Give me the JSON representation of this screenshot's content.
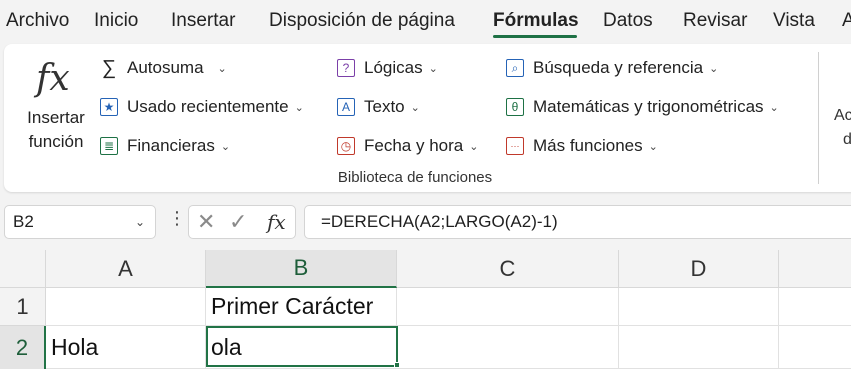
{
  "menu": {
    "tabs": [
      "Archivo",
      "Inicio",
      "Insertar",
      "Disposición de página",
      "Fórmulas",
      "Datos",
      "Revisar",
      "Vista",
      "A"
    ],
    "active": "Fórmulas"
  },
  "ribbon": {
    "insert_function": {
      "icon": "fx-icon",
      "glyph": "fx",
      "label_line1": "Insertar",
      "label_line2": "función"
    },
    "buttons": [
      {
        "id": "autosuma",
        "label": "Autosuma",
        "icon": "sigma-icon",
        "glyph": "∑",
        "dropdown": true
      },
      {
        "id": "usado",
        "label": "Usado recientemente",
        "icon": "star-book-icon",
        "glyph": "★",
        "dropdown": true
      },
      {
        "id": "financieras",
        "label": "Financieras",
        "icon": "database-book-icon",
        "glyph": "≣",
        "dropdown": true
      },
      {
        "id": "logicas",
        "label": "Lógicas",
        "icon": "question-book-icon",
        "glyph": "?",
        "dropdown": true
      },
      {
        "id": "texto",
        "label": "Texto",
        "icon": "text-book-icon",
        "glyph": "A",
        "dropdown": true
      },
      {
        "id": "fecha",
        "label": "Fecha y hora",
        "icon": "clock-book-icon",
        "glyph": "◷",
        "dropdown": true
      },
      {
        "id": "busqueda",
        "label": "Búsqueda y referencia",
        "icon": "search-book-icon",
        "glyph": "⌕",
        "dropdown": true
      },
      {
        "id": "matematicas",
        "label": "Matemáticas y trigonométricas",
        "icon": "theta-book-icon",
        "glyph": "θ",
        "dropdown": true
      },
      {
        "id": "mas",
        "label": "Más funciones",
        "icon": "more-book-icon",
        "glyph": "···",
        "dropdown": true
      }
    ],
    "group_label": "Biblioteca de funciones",
    "cut_off_text_line1": "Ac",
    "cut_off_text_line2": "d"
  },
  "formula_bar": {
    "name_box": "B2",
    "cancel_glyph": "✕",
    "enter_glyph": "✓",
    "fx_glyph": "fx",
    "formula": "=DERECHA(A2;LARGO(A2)-1)"
  },
  "sheet": {
    "columns": [
      "A",
      "B",
      "C",
      "D"
    ],
    "rows": [
      "1",
      "2"
    ],
    "cells": {
      "A1": "",
      "B1": "Primer Carácter",
      "C1": "",
      "D1": "",
      "A2": "Hola",
      "B2": "ola",
      "C2": "",
      "D2": ""
    },
    "selected": "B2",
    "accent_color": "#217346"
  }
}
